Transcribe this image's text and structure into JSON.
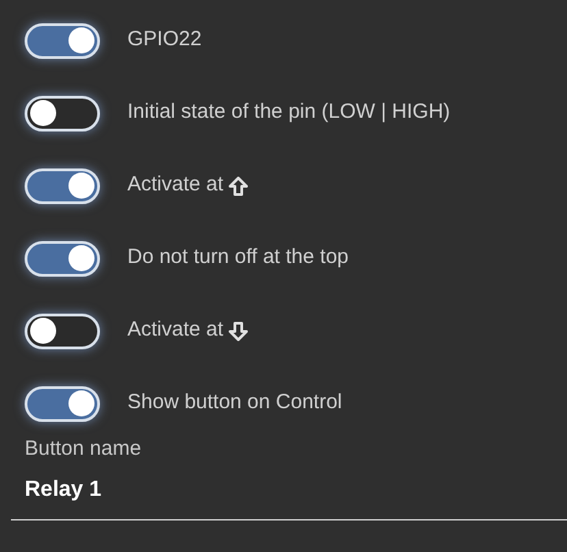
{
  "switches": [
    {
      "label": "GPIO22",
      "on": true
    },
    {
      "label": "Initial state of the pin (LOW | HIGH)",
      "on": false
    },
    {
      "label": "Activate at",
      "on": true,
      "kind": "up"
    },
    {
      "label": "Do not turn off at the top",
      "on": true
    },
    {
      "label": "Activate at",
      "on": false,
      "kind": "down"
    },
    {
      "label": "Show button on Control",
      "on": true
    }
  ],
  "field": {
    "label": "Button name",
    "value": "Relay 1"
  }
}
